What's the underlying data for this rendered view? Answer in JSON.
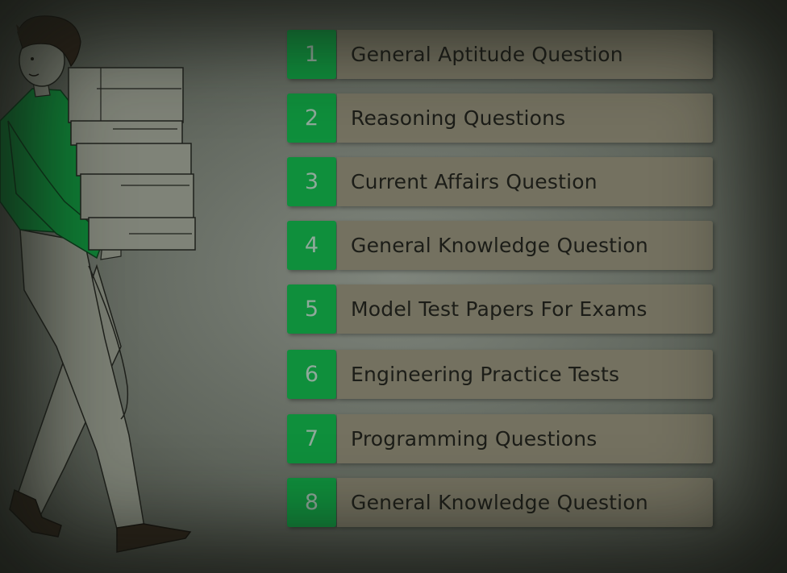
{
  "items": [
    {
      "number": "1",
      "label": "General Aptitude Question"
    },
    {
      "number": "2",
      "label": "Reasoning Questions"
    },
    {
      "number": "3",
      "label": "Current Affairs Question"
    },
    {
      "number": "4",
      "label": "General Knowledge Question"
    },
    {
      "number": "5",
      "label": "Model Test Papers For Exams"
    },
    {
      "number": "6",
      "label": "Engineering Practice Tests"
    },
    {
      "number": "7",
      "label": "Programming Questions"
    },
    {
      "number": "8",
      "label": "General Knowledge Question"
    }
  ],
  "colors": {
    "accent_green": "#0f8f3c",
    "label_background": "#747160",
    "background": "#6f756c"
  },
  "illustration": "man-carrying-stack-of-papers"
}
